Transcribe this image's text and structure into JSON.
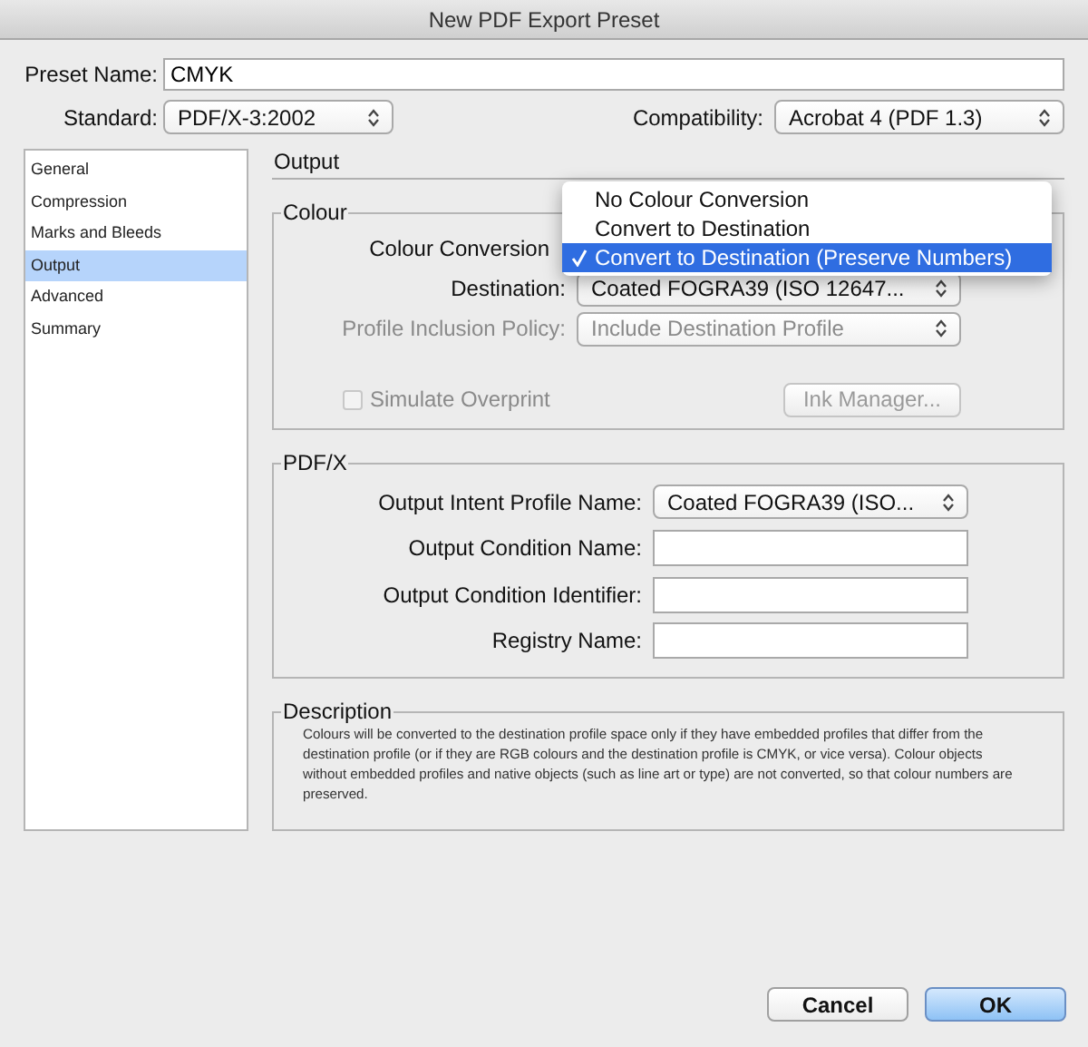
{
  "window": {
    "title": "New PDF Export Preset"
  },
  "preset_name": {
    "label": "Preset Name:",
    "value": "CMYK"
  },
  "standard": {
    "label": "Standard:",
    "value": "PDF/X-3:2002"
  },
  "compatibility": {
    "label": "Compatibility:",
    "value": "Acrobat 4 (PDF 1.3)"
  },
  "sidebar": {
    "items": [
      {
        "label": "General",
        "selected": false
      },
      {
        "label": "Compression",
        "selected": false
      },
      {
        "label": "Marks and Bleeds",
        "selected": false
      },
      {
        "label": "Output",
        "selected": true
      },
      {
        "label": "Advanced",
        "selected": false
      },
      {
        "label": "Summary",
        "selected": false
      }
    ]
  },
  "section_title": "Output",
  "colour": {
    "title": "Colour",
    "conversion_label": "Colour Conversion",
    "destination": {
      "label": "Destination:",
      "value": "Coated FOGRA39 (ISO 12647...",
      "disabled": false
    },
    "profile_inclusion": {
      "label": "Profile Inclusion Policy:",
      "value": "Include Destination Profile",
      "disabled": true
    },
    "simulate_overprint": {
      "label": "Simulate Overprint",
      "checked": false,
      "disabled": true
    },
    "ink_manager": {
      "label": "Ink Manager...",
      "disabled": true
    },
    "conversion_menu": [
      {
        "label": "No Colour Conversion",
        "selected": false
      },
      {
        "label": "Convert to Destination",
        "selected": false
      },
      {
        "label": "Convert to Destination (Preserve Numbers)",
        "selected": true
      }
    ]
  },
  "pdfx": {
    "title": "PDF/X",
    "output_intent": {
      "label": "Output Intent Profile Name:",
      "value": "Coated FOGRA39 (ISO..."
    },
    "fields": [
      {
        "label": "Output Condition Name:"
      },
      {
        "label": "Output Condition Identifier:"
      },
      {
        "label": "Registry Name:"
      }
    ]
  },
  "description": {
    "title": "Description",
    "text": "Colours will be converted to the destination profile space only if they have embedded profiles that differ from the destination profile (or if they are RGB colours and the destination profile is CMYK, or vice versa). Colour objects without embedded profiles and native objects (such as line art or type) are not converted, so that colour numbers are preserved."
  },
  "buttons": [
    {
      "label": "Cancel",
      "kind": "normal"
    },
    {
      "label": "OK",
      "kind": "default"
    }
  ]
}
